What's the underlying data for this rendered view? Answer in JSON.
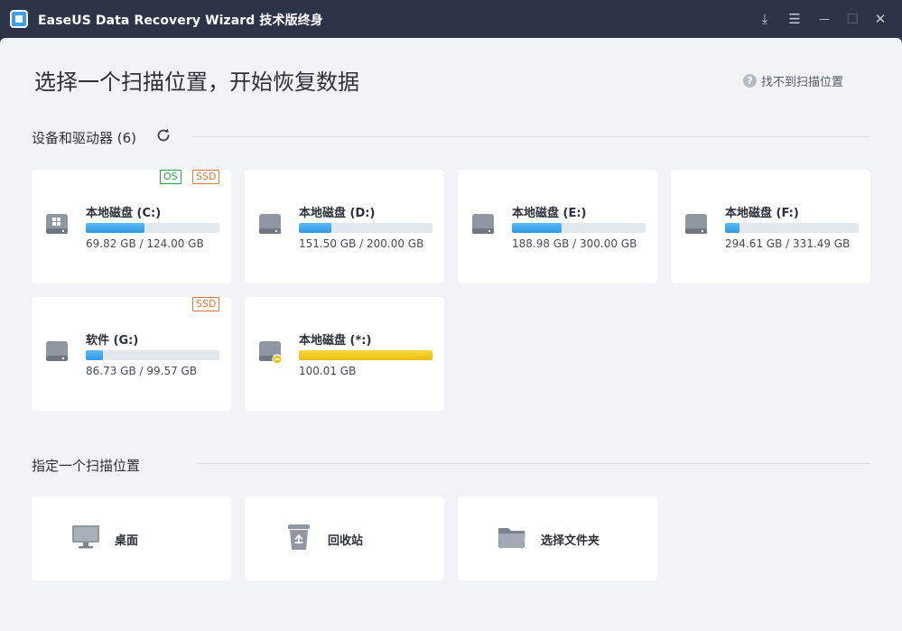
{
  "window": {
    "title": "EaseUS Data Recovery Wizard 技术版终身",
    "buttons": [
      {
        "name": "download-icon",
        "glyph": "⤓"
      },
      {
        "name": "menu-icon",
        "glyph": "☰"
      },
      {
        "name": "minimize-icon",
        "glyph": "—"
      },
      {
        "name": "maximize-icon",
        "glyph": "☐"
      },
      {
        "name": "close-icon",
        "glyph": "✕"
      }
    ]
  },
  "header": {
    "title": "选择一个扫描位置，开始恢复数据",
    "help_icon": "?",
    "help_label": "找不到扫描位置"
  },
  "devices": {
    "title": "设备和驱动器 (6)",
    "drives": [
      {
        "name": "本地磁盘 (C:)",
        "size": "69.82 GB / 124.00 GB",
        "used_fraction": 0.44,
        "tags": [
          "OS",
          "SSD"
        ],
        "icon": "windows-drive-icon",
        "bar": "blue"
      },
      {
        "name": "本地磁盘 (D:)",
        "size": "151.50 GB / 200.00 GB",
        "used_fraction": 0.24,
        "tags": [],
        "icon": "drive-icon",
        "bar": "blue"
      },
      {
        "name": "本地磁盘 (E:)",
        "size": "188.98 GB / 300.00 GB",
        "used_fraction": 0.37,
        "tags": [],
        "icon": "drive-icon",
        "bar": "blue"
      },
      {
        "name": "本地磁盘 (F:)",
        "size": "294.61 GB / 331.49 GB",
        "used_fraction": 0.11,
        "tags": [],
        "icon": "drive-icon",
        "bar": "blue"
      },
      {
        "name": "软件 (G:)",
        "size": "86.73 GB / 99.57 GB",
        "used_fraction": 0.13,
        "tags": [
          "SSD"
        ],
        "icon": "drive-icon",
        "bar": "blue"
      },
      {
        "name": "本地磁盘 (*:)",
        "size": "100.01 GB",
        "used_fraction": 1.0,
        "tags": [],
        "icon": "lost-partition-drive-icon",
        "bar": "yellow"
      }
    ]
  },
  "locations": {
    "title": "指定一个扫描位置",
    "items": [
      {
        "label": "桌面",
        "icon": "desktop-icon"
      },
      {
        "label": "回收站",
        "icon": "recycle-bin-icon"
      },
      {
        "label": "选择文件夹",
        "icon": "folder-icon"
      }
    ]
  }
}
